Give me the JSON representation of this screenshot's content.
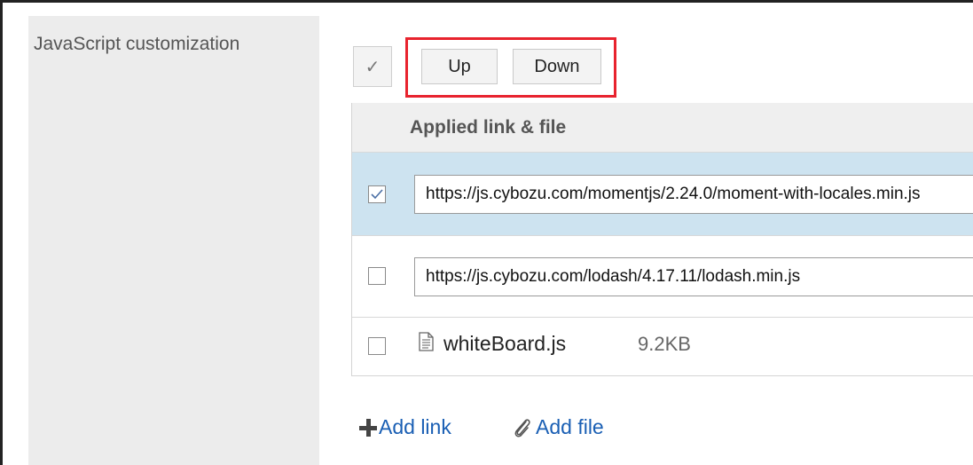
{
  "section": {
    "label": "JavaScript customization"
  },
  "toolbar": {
    "select_all_glyph": "✓",
    "up_label": "Up",
    "down_label": "Down"
  },
  "table": {
    "header": "Applied link & file",
    "rows": [
      {
        "type": "link",
        "checked": true,
        "value": "https://js.cybozu.com/momentjs/2.24.0/moment-with-locales.min.js"
      },
      {
        "type": "link",
        "checked": false,
        "value": "https://js.cybozu.com/lodash/4.17.11/lodash.min.js"
      },
      {
        "type": "file",
        "checked": false,
        "name": "whiteBoard.js",
        "size": "9.2KB",
        "icon": "file-icon"
      }
    ]
  },
  "actions": {
    "add_link_label": "Add link",
    "add_file_label": "Add file"
  },
  "colors": {
    "highlight_border": "#e8232e",
    "selected_row_bg": "#cde3f0",
    "link_color": "#1a5fb4"
  }
}
